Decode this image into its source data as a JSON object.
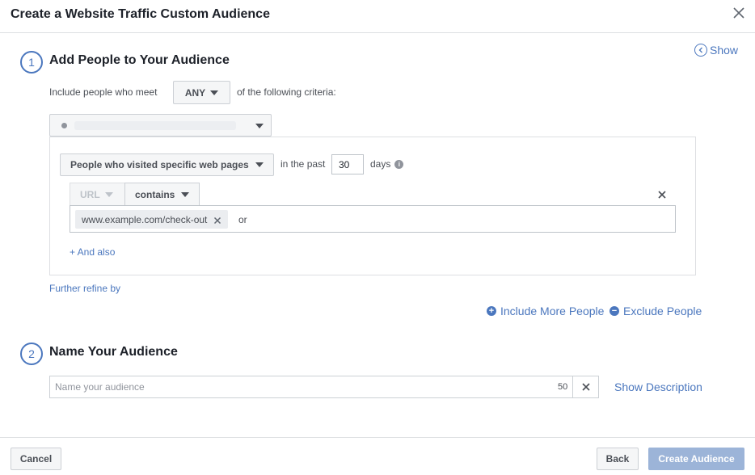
{
  "dialog": {
    "title": "Create a Website Traffic Custom Audience",
    "show_label": "Show"
  },
  "step1": {
    "number": "1",
    "title": "Add People to Your Audience",
    "criteria_prefix": "Include people who meet",
    "match_value": "ANY",
    "criteria_suffix": "of the following criteria:",
    "rule": {
      "event_select": "People who visited specific web pages",
      "in_the_past": "in the past",
      "days_value": "30",
      "days_label": "days",
      "url_select": "URL",
      "operator_select": "contains",
      "token": "www.example.com/check-out",
      "or_label": "or",
      "and_also": "+ And also"
    },
    "further_refine": "Further refine by",
    "include_more": "Include More People",
    "exclude": "Exclude People"
  },
  "step2": {
    "number": "2",
    "title": "Name Your Audience",
    "name_placeholder": "Name your audience",
    "name_value": "",
    "char_count": "50",
    "show_description": "Show Description"
  },
  "footer": {
    "cancel": "Cancel",
    "back": "Back",
    "create": "Create Audience"
  },
  "colors": {
    "accent": "#4b77be",
    "create_disabled": "#9cb4d8"
  }
}
